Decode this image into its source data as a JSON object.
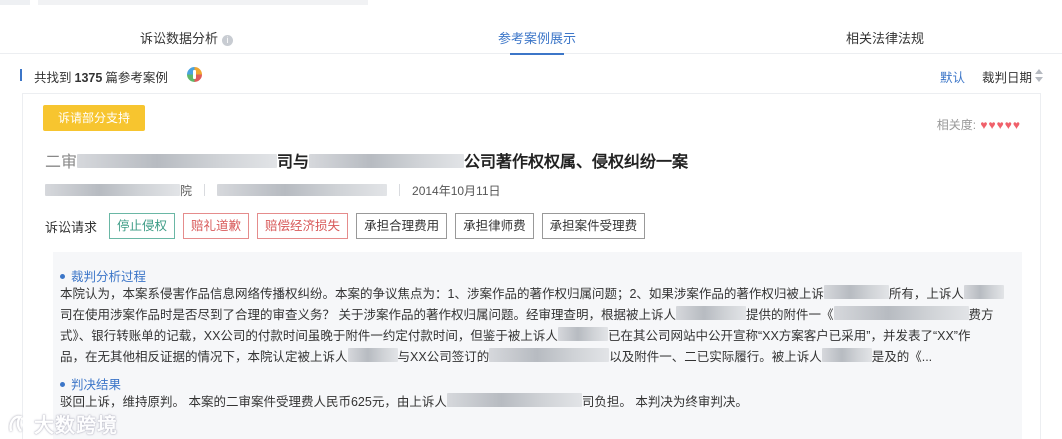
{
  "tabs": [
    {
      "label": "诉讼数据分析",
      "info_icon": "i"
    },
    {
      "label": "参考案例展示"
    },
    {
      "label": "相关法律法规"
    }
  ],
  "summary": {
    "prefix": "共找到",
    "count": "1375",
    "suffix": "篇参考案例"
  },
  "sort": {
    "default_label": "默认",
    "date_label": "裁判日期"
  },
  "card": {
    "tag": "诉请部分支持",
    "relevance_label": "相关度:",
    "relevance_score": 5,
    "title_prefix": "二审",
    "title_mid": "司与",
    "title_suffix": "公司著作权权属、侵权纠纷一案",
    "court_suffix": "院",
    "date": "2014年10月11日",
    "claims_label": "诉讼请求",
    "claims": [
      {
        "label": "停止侵权",
        "style": "green"
      },
      {
        "label": "赔礼道歉",
        "style": "red"
      },
      {
        "label": "赔偿经济损失",
        "style": "red"
      },
      {
        "label": "承担合理费用",
        "style": "normal"
      },
      {
        "label": "承担律师费",
        "style": "normal"
      },
      {
        "label": "承担案件受理费",
        "style": "normal"
      }
    ],
    "analysis_title": "裁判分析过程",
    "analysis_lines": [
      "本院认为，本案系侵害作品信息网络传播权纠纷。本案的争议焦点为：1、涉案作品的著作权归属问题；2、如果涉案作品的著作权归被上诉",
      "所有，上诉人",
      "司在使用涉案作品时是否尽到了合理的审查义务？ 关于涉案作品的著作权归属问题。经审理查明，根据被上诉人",
      "提供的附件一《",
      "费方",
      "式》、银行转账单的记载，XX公司的付款时间虽晚于附件一约定付款时间，但鉴于被上诉人",
      "已在其公司网站中公开宣称“XX方案客户已采用”，并发表了“XX”作",
      "品，在无其他相反证据的情况下，本院认定被上诉人",
      "与XX公司签订的",
      "以及附件一、二已实际履行。被上诉人",
      "是及的《..."
    ],
    "judgment_title": "判决结果",
    "judgment_prefix": "驳回上诉，维持原判。 本案的二审案件受理费人民币625元，由上诉人",
    "judgment_suffix": "司负担。 本判决为终审判决。"
  },
  "watermark": "大数跨境",
  "colors": {
    "accent": "#3c76c8",
    "tag_bg": "#f7c52f",
    "heart": "#f0606a",
    "green": "#3c9c86",
    "red": "#d85a5a"
  }
}
